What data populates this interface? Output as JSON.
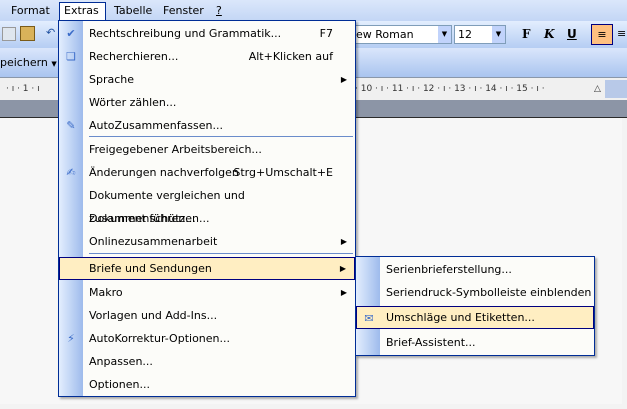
{
  "menubar": {
    "format": "Format",
    "extras": "Extras",
    "tabelle": "Tabelle",
    "fenster": "Fenster",
    "help": "?"
  },
  "toolbar": {
    "font": "ew Roman",
    "size": "12",
    "bold": "F",
    "italic": "K",
    "underline": "U",
    "save": "peichern"
  },
  "ruler": {
    "ticks": "·  ı · 1 ·  ı",
    "ticks_right": "· 10 ·  ı · 11 ·  ı · 12 ·  ı · 13 ·  ı · 14 ·  ı · 15 ·  ı ·"
  },
  "extras_menu": [
    {
      "label": "Rechtschreibung und Grammatik...",
      "shortcut": "F7",
      "icon": "spellcheck-icon"
    },
    {
      "label": "Recherchieren...",
      "shortcut": "Alt+Klicken auf",
      "icon": "research-icon"
    },
    {
      "label": "Sprache",
      "submenu": true
    },
    {
      "label": "Wörter zählen..."
    },
    {
      "label": "AutoZusammenfassen...",
      "icon": "autosummarize-icon"
    },
    {
      "label": "Freigegebener Arbeitsbereich..."
    },
    {
      "label": "Änderungen nachverfolgen",
      "shortcut": "Strg+Umschalt+E",
      "icon": "track-changes-icon"
    },
    {
      "label": "Dokumente vergleichen und zusammenführen..."
    },
    {
      "label": "Dokument schützen..."
    },
    {
      "label": "Onlinezusammenarbeit",
      "submenu": true
    },
    {
      "label": "Briefe und Sendungen",
      "submenu": true,
      "highlighted": true
    },
    {
      "label": "Makro",
      "submenu": true
    },
    {
      "label": "Vorlagen und Add-Ins..."
    },
    {
      "label": "AutoKorrektur-Optionen...",
      "icon": "autocorrect-icon"
    },
    {
      "label": "Anpassen..."
    },
    {
      "label": "Optionen..."
    }
  ],
  "submenu": [
    {
      "label": "Serienbrieferstellung..."
    },
    {
      "label": "Seriendruck-Symbolleiste einblenden"
    },
    {
      "label": "Umschläge und Etiketten...",
      "highlighted": true,
      "icon": "envelope-icon"
    },
    {
      "label": "Brief-Assistent..."
    }
  ]
}
